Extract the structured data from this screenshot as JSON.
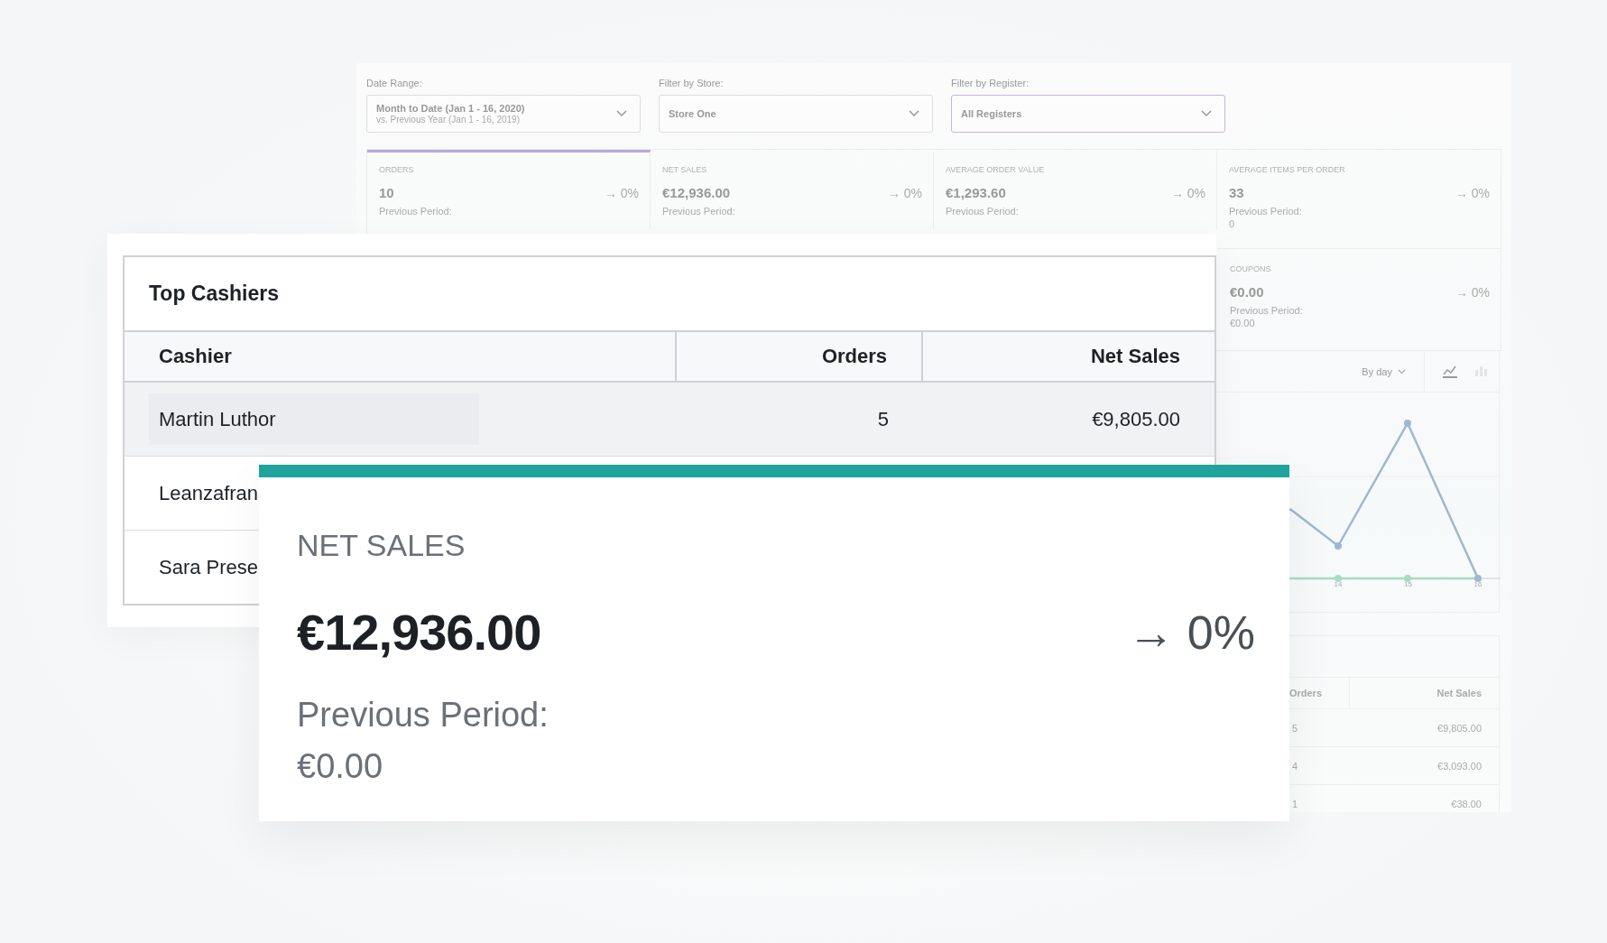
{
  "dashboard": {
    "filters": [
      {
        "label": "Date Range:",
        "value": "Month to Date (Jan 1 - 16, 2020)",
        "subvalue": "vs. Previous Year (Jan 1 - 16, 2019)",
        "selected": false
      },
      {
        "label": "Filter by Store:",
        "value": "Store One",
        "selected": false
      },
      {
        "label": "Filter by Register:",
        "value": "All Registers",
        "selected": true
      }
    ],
    "stats": [
      {
        "label": "ORDERS",
        "value": "10",
        "change": "→ 0%",
        "previous_label": "Previous Period:",
        "selected": true
      },
      {
        "label": "NET SALES",
        "value": "€12,936.00",
        "change": "→ 0%",
        "previous_label": "Previous Period:",
        "selected": false
      },
      {
        "label": "AVERAGE ORDER VALUE",
        "value": "€1,293.60",
        "change": "→ 0%",
        "previous_label": "Previous Period:",
        "selected": false
      },
      {
        "label": "AVERAGE ITEMS PER ORDER",
        "value": "33",
        "change": "→ 0%",
        "previous_label": "Previous Period:",
        "previous_value": "0",
        "selected": false
      },
      {
        "label": "COUPONS",
        "value": "€0.00",
        "change": "→ 0%",
        "previous_label": "Previous Period:",
        "previous_value": "€0.00",
        "selected": false
      }
    ],
    "chart": {
      "interval": "By day",
      "chart_types": [
        {
          "kind": "line",
          "selected": true
        },
        {
          "kind": "bar",
          "selected": false
        }
      ],
      "x_labels": [
        "14",
        "15",
        "16"
      ]
    },
    "table": {
      "columns": [
        "Orders",
        "Net Sales"
      ],
      "rows": [
        {
          "orders": "5",
          "net_sales": "€9,805.00"
        },
        {
          "orders": "4",
          "net_sales": "€3,093.00"
        },
        {
          "orders": "1",
          "net_sales": "€38.00"
        }
      ]
    }
  },
  "top_cashiers": {
    "title": "Top Cashiers",
    "columns": [
      "Cashier",
      "Orders",
      "Net Sales"
    ],
    "rows": [
      {
        "cashier": "Martin Luthor",
        "orders": "5",
        "net_sales": "€9,805.00",
        "selected": true
      },
      {
        "cashier": "Leanzafran",
        "selected": false
      },
      {
        "cashier": "Sara Prese",
        "selected": false
      }
    ]
  },
  "net_sales_card": {
    "label": "NET SALES",
    "value": "€12,936.00",
    "change": "→ 0%",
    "previous_label": "Previous Period:",
    "previous_value": "€0.00"
  }
}
